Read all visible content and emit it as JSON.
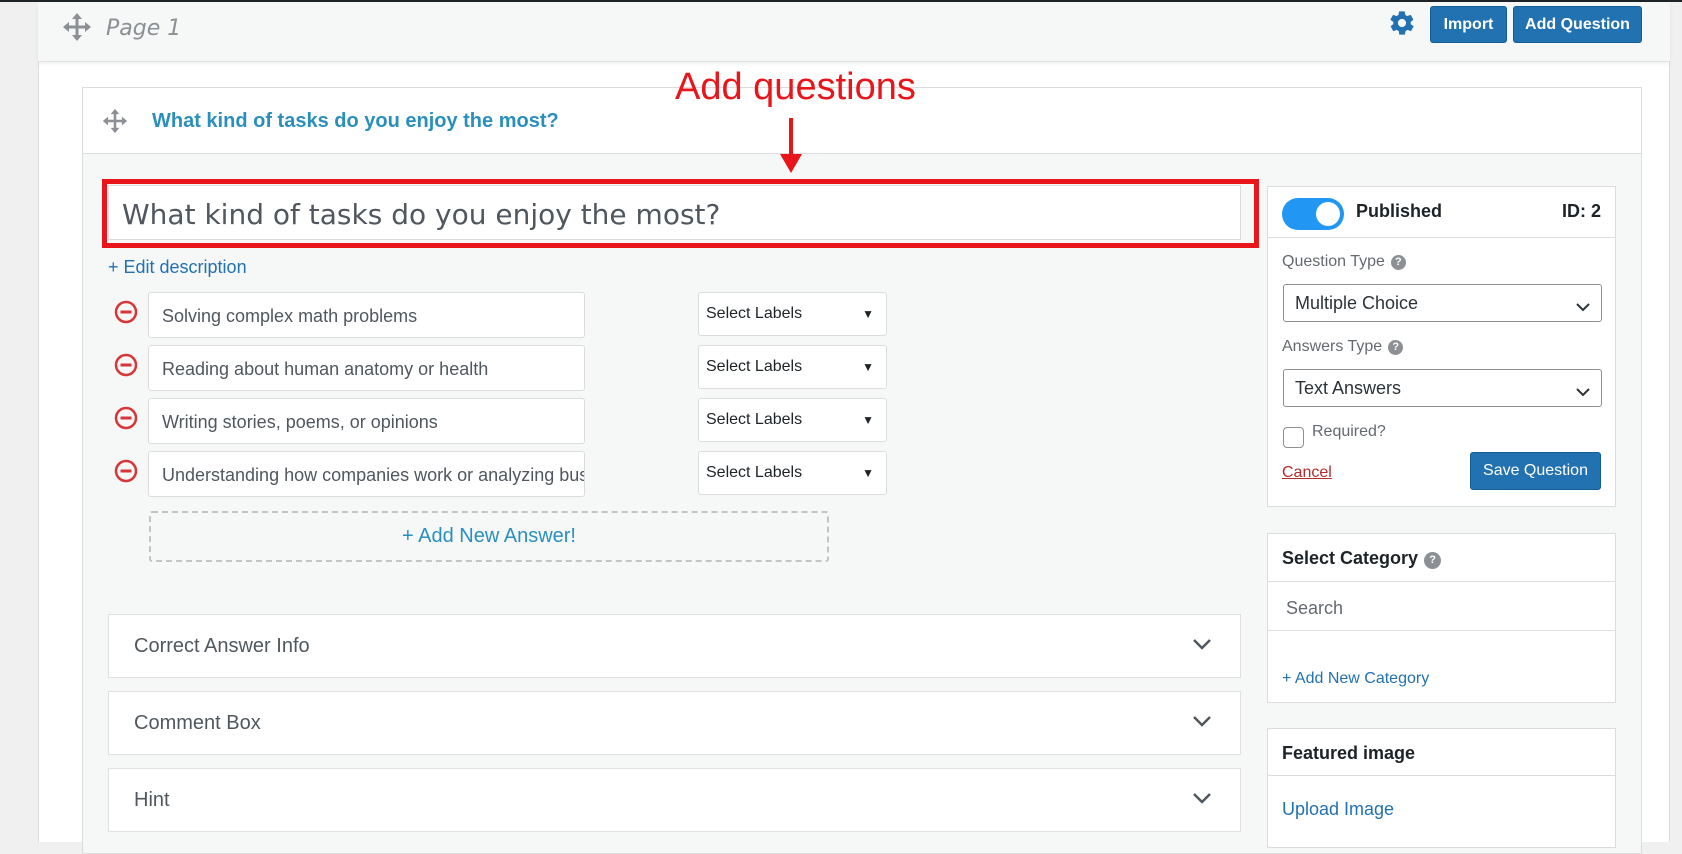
{
  "page": {
    "title": "Page 1",
    "import_label": "Import",
    "add_question_label": "Add Question"
  },
  "annotation": {
    "text": "Add questions"
  },
  "question": {
    "header_title": "What kind of tasks do you enjoy the most?",
    "title_value": "What kind of tasks do you enjoy the most?",
    "edit_description": "+ Edit description",
    "answers": [
      {
        "text": "Solving complex math problems",
        "labels": "Select Labels"
      },
      {
        "text": "Reading about human anatomy or health",
        "labels": "Select Labels"
      },
      {
        "text": "Writing stories, poems, or opinions",
        "labels": "Select Labels"
      },
      {
        "text": "Understanding how companies work or analyzing bus",
        "labels": "Select Labels"
      }
    ],
    "add_answer": "+ Add New Answer!",
    "sections": [
      "Correct Answer Info",
      "Comment Box",
      "Hint"
    ]
  },
  "sidebar": {
    "status": "Published",
    "id": "ID: 2",
    "question_type_label": "Question Type",
    "question_type_value": "Multiple Choice",
    "answers_type_label": "Answers Type",
    "answers_type_value": "Text Answers",
    "required_label": "Required?",
    "cancel_label": "Cancel",
    "save_label": "Save Question",
    "category_title": "Select Category",
    "category_search_placeholder": "Search",
    "add_category": "+ Add New Category",
    "featured_title": "Featured image",
    "upload_label": "Upload Image"
  },
  "colors": {
    "accent": "#2271b1",
    "link": "#2a8fbd",
    "annotation": "#e8151b",
    "toggle_on": "#2196f3",
    "remove_icon": "#d63638"
  },
  "icons": [
    "move-icon",
    "gear-icon",
    "minus-circle-icon",
    "caret-down-icon",
    "chevron-down-icon",
    "help-icon"
  ]
}
